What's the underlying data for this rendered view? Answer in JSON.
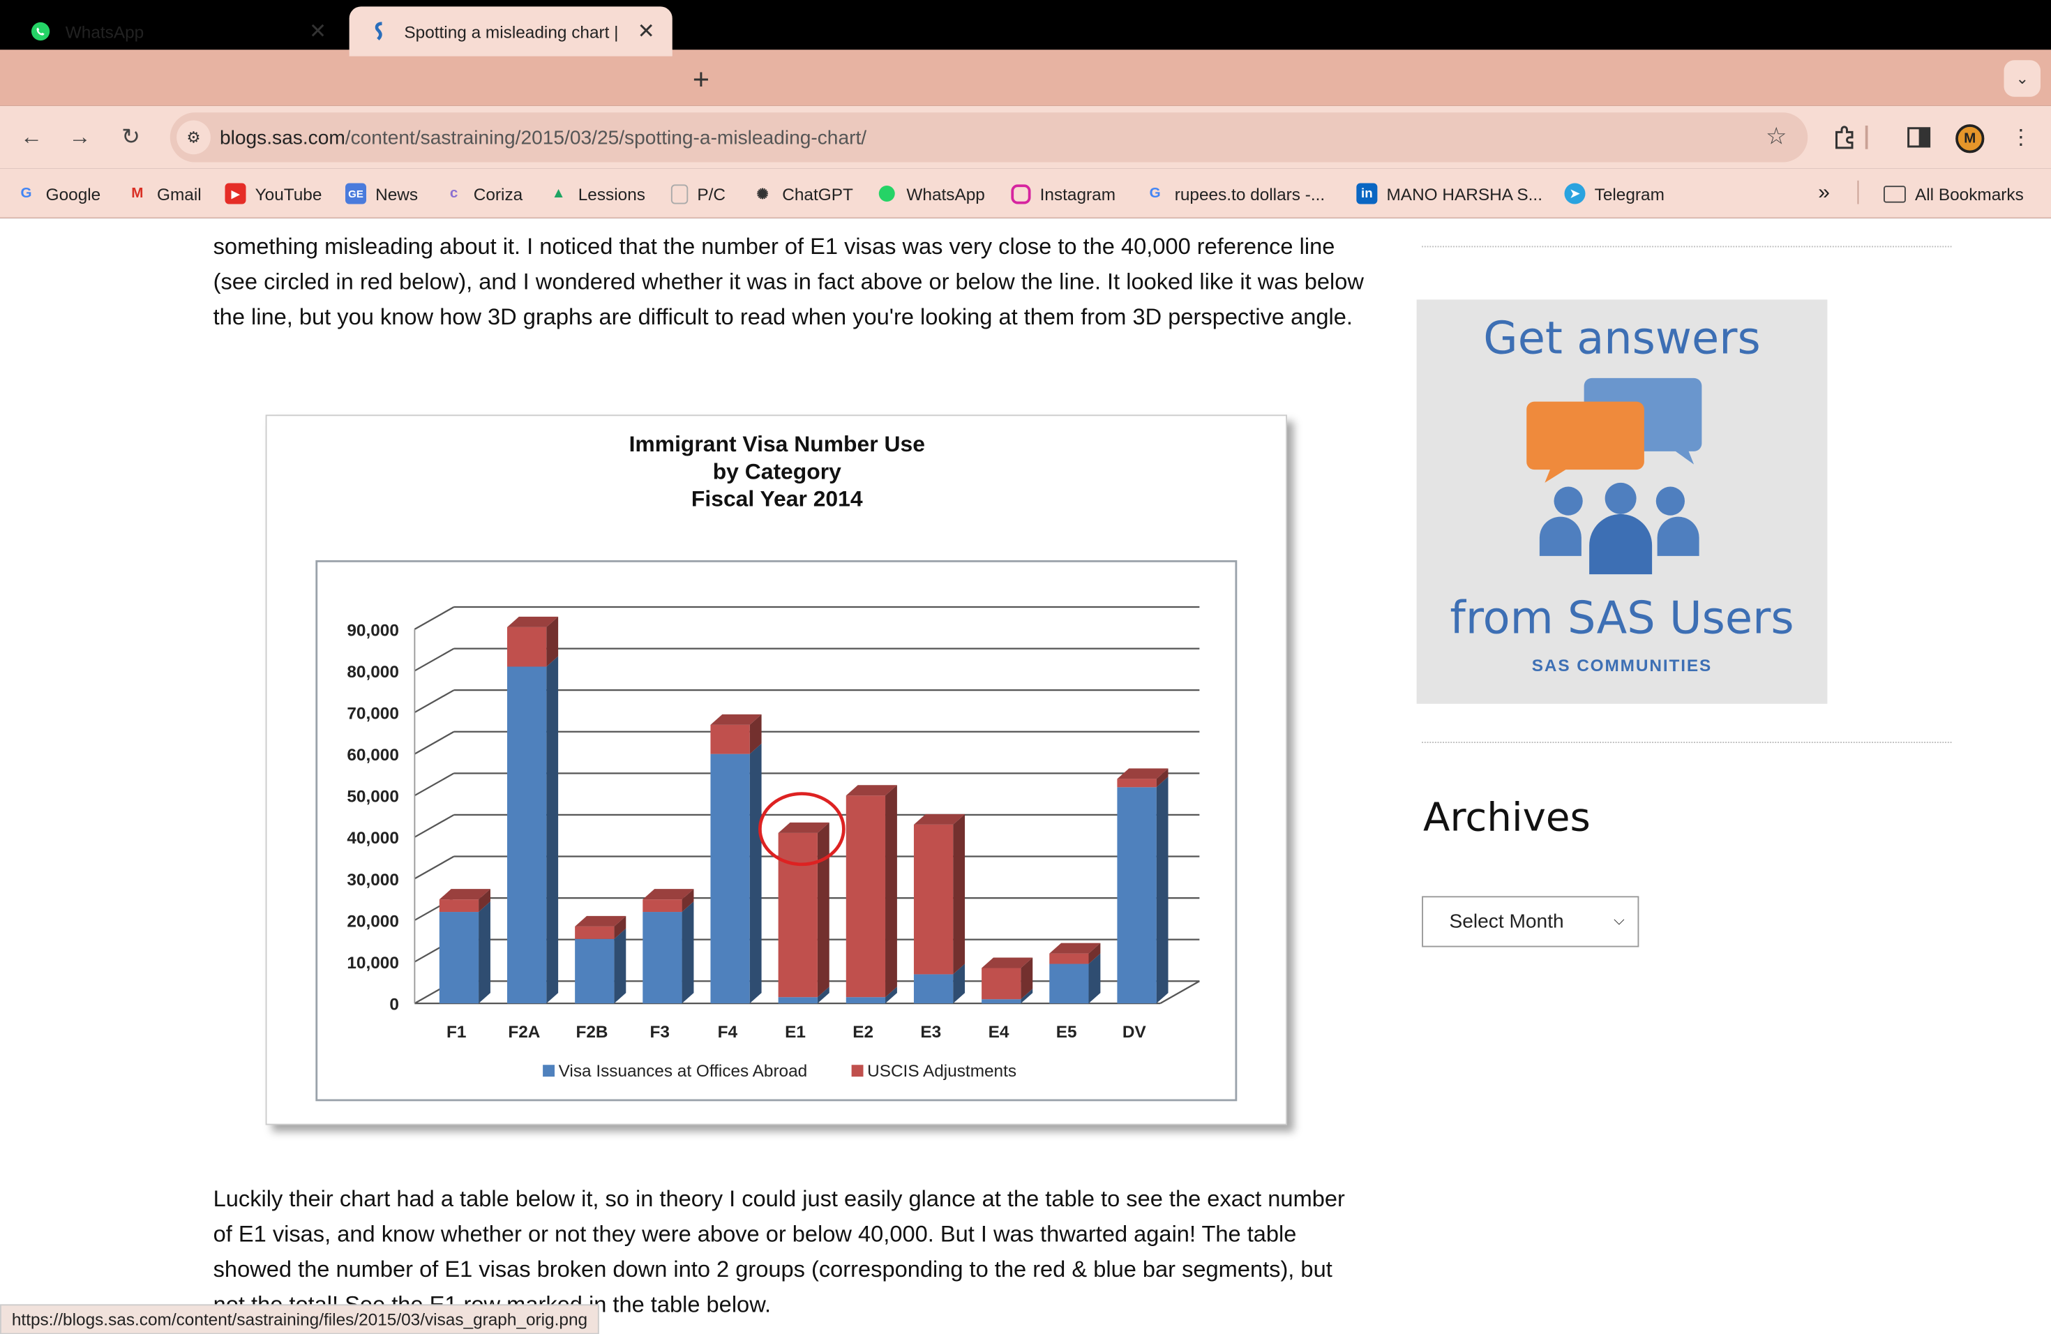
{
  "tabs": [
    {
      "title": "WhatsApp",
      "icon": "whatsapp-icon",
      "active": false
    },
    {
      "title": "Spotting a misleading chart |",
      "icon": "sas-icon",
      "active": true
    }
  ],
  "toolbar": {
    "url_host": "blogs.sas.com",
    "url_path": "/content/sastraining/2015/03/25/spotting-a-misleading-chart/"
  },
  "profile": {
    "initial": "M"
  },
  "bookmarks": [
    {
      "label": "Google",
      "icon": "google-icon"
    },
    {
      "label": "Gmail",
      "icon": "gmail-icon"
    },
    {
      "label": "YouTube",
      "icon": "youtube-icon"
    },
    {
      "label": "News",
      "icon": "news-icon"
    },
    {
      "label": "Coriza",
      "icon": "coriza-icon"
    },
    {
      "label": "Lessions",
      "icon": "drive-icon"
    },
    {
      "label": "P/C",
      "icon": "page-icon"
    },
    {
      "label": "ChatGPT",
      "icon": "chatgpt-icon"
    },
    {
      "label": "WhatsApp",
      "icon": "whatsapp-icon"
    },
    {
      "label": "Instagram",
      "icon": "instagram-icon"
    },
    {
      "label": "rupees.to dollars -...",
      "icon": "google-icon"
    },
    {
      "label": "MANO HARSHA S...",
      "icon": "linkedin-icon"
    },
    {
      "label": "Telegram",
      "icon": "telegram-icon"
    }
  ],
  "bookmarks_all": "All Bookmarks",
  "article": {
    "p1": "something misleading about it. I noticed that the number of E1 visas was very close to the 40,000 reference line (see circled in red below), and I wondered whether it was in fact above or below the line. It looked like it was below the line, but you know how 3D graphs are difficult to read when you're looking at them from 3D perspective angle.",
    "p2": "Luckily their chart had a table below it, so in theory I could just easily glance at the table to see the exact number of E1 visas, and know whether or not they were above or below 40,000. But I was thwarted again! The table showed the number of E1 visas broken down into 2 groups (corresponding to the red & blue bar segments), but not the total! See the E1 row marked in the table below."
  },
  "chart_data": {
    "type": "bar",
    "stacked": true,
    "title": "Immigrant Visa Number Use\nby Category\nFiscal Year 2014",
    "title_lines": [
      "Immigrant Visa Number Use",
      "by Category",
      "Fiscal Year 2014"
    ],
    "categories": [
      "F1",
      "F2A",
      "F2B",
      "F3",
      "F4",
      "E1",
      "E2",
      "E3",
      "E4",
      "E5",
      "DV"
    ],
    "series": [
      {
        "name": "Visa Issuances at Offices Abroad",
        "color": "#4f81bd",
        "values": [
          22000,
          81000,
          15500,
          22000,
          60000,
          1500,
          1500,
          7000,
          1000,
          9500,
          52000
        ]
      },
      {
        "name": "USCIS Adjustments",
        "color": "#c0504d",
        "values": [
          3000,
          9500,
          3000,
          3000,
          7000,
          39500,
          48500,
          36000,
          7500,
          2500,
          2000
        ]
      }
    ],
    "ylim": [
      0,
      90000
    ],
    "y_ticks": [
      "0",
      "10,000",
      "20,000",
      "30,000",
      "40,000",
      "50,000",
      "60,000",
      "70,000",
      "80,000",
      "90,000"
    ],
    "grid": true,
    "legend_position": "bottom",
    "annotation": {
      "target": "E1",
      "shape": "circle",
      "color": "#dd2222"
    },
    "xlabel": "",
    "ylabel": ""
  },
  "sidebar": {
    "ad_top": "Get answers",
    "ad_bottom": "from SAS Users",
    "ad_sub": "SAS COMMUNITIES",
    "archives_title": "Archives",
    "archives_select": "Select Month"
  },
  "status_url": "https://blogs.sas.com/content/sastraining/files/2015/03/visas_graph_orig.png",
  "colors": {
    "tabstrip": "#e7b3a2",
    "toolbar": "#f7dcd3",
    "blue_bar": "#4f81bd",
    "red_bar": "#c0504d"
  }
}
